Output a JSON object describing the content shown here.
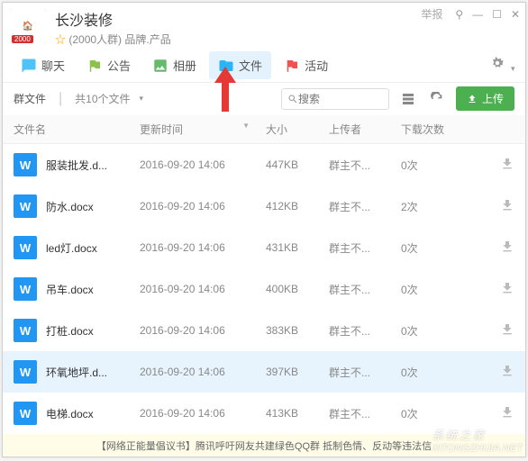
{
  "header": {
    "title": "长沙装修",
    "star": "☆",
    "group_size": "(2000人群)",
    "tags": "品牌.产品",
    "badge": "2000",
    "report": "举报"
  },
  "win_controls": {
    "pin": "⚲",
    "min": "—",
    "max": "☐",
    "close": "✕"
  },
  "tabs": [
    {
      "icon": "chat",
      "label": "聊天"
    },
    {
      "icon": "notice",
      "label": "公告"
    },
    {
      "icon": "album",
      "label": "相册"
    },
    {
      "icon": "files",
      "label": "文件",
      "active": true
    },
    {
      "icon": "activity",
      "label": "活动"
    }
  ],
  "toolbar": {
    "path": "群文件",
    "count": "共10个文件",
    "search_placeholder": "搜索",
    "upload_label": "上传"
  },
  "columns": {
    "name": "文件名",
    "time": "更新时间",
    "size": "大小",
    "uploader": "上传者",
    "downloads": "下载次数"
  },
  "files": [
    {
      "icon": "W",
      "name": "服装批发.d...",
      "time": "2016-09-20 14:06",
      "size": "447KB",
      "uploader": "群主不...",
      "downloads": "0次"
    },
    {
      "icon": "W",
      "name": "防水.docx",
      "time": "2016-09-20 14:06",
      "size": "412KB",
      "uploader": "群主不...",
      "downloads": "2次"
    },
    {
      "icon": "W",
      "name": "led灯.docx",
      "time": "2016-09-20 14:06",
      "size": "431KB",
      "uploader": "群主不...",
      "downloads": "0次"
    },
    {
      "icon": "W",
      "name": "吊车.docx",
      "time": "2016-09-20 14:06",
      "size": "400KB",
      "uploader": "群主不...",
      "downloads": "0次"
    },
    {
      "icon": "W",
      "name": "打桩.docx",
      "time": "2016-09-20 14:06",
      "size": "383KB",
      "uploader": "群主不...",
      "downloads": "0次"
    },
    {
      "icon": "W",
      "name": "环氧地坪.d...",
      "time": "2016-09-20 14:06",
      "size": "397KB",
      "uploader": "群主不...",
      "downloads": "0次",
      "selected": true
    },
    {
      "icon": "W",
      "name": "电梯.docx",
      "time": "2016-09-20 14:06",
      "size": "413KB",
      "uploader": "群主不...",
      "downloads": "0次"
    }
  ],
  "footer": {
    "text": "【网络正能量倡议书】腾讯呼吁网友共建绿色QQ群 抵制色情、反动等违法信"
  },
  "watermark": {
    "line1": "系统之家",
    "line2": "XITONGZHIJIA.NET"
  }
}
